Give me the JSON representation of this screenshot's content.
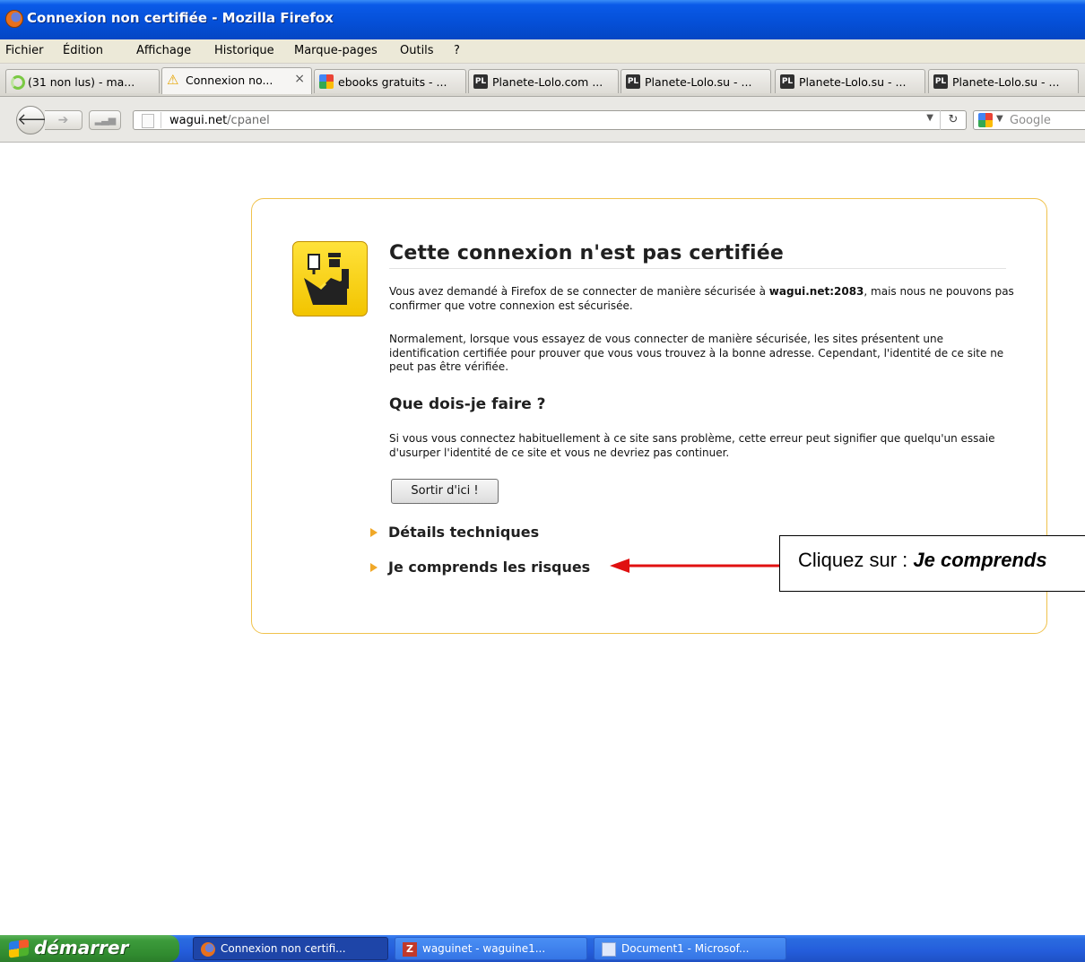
{
  "window": {
    "title": "Connexion non certifiée - Mozilla Firefox"
  },
  "menu": [
    "Fichier",
    "Édition",
    "Affichage",
    "Historique",
    "Marque-pages",
    "Outils",
    "?"
  ],
  "tabs": [
    {
      "label": "(31 non lus) - ma...",
      "icon": "loading-spinner-icon"
    },
    {
      "label": "Connexion no...",
      "icon": "warning-icon",
      "active": true,
      "close": "×"
    },
    {
      "label": "ebooks gratuits - ...",
      "icon": "google-icon"
    },
    {
      "label": "Planete-Lolo.com ...",
      "icon": "pl-icon"
    },
    {
      "label": "Planete-Lolo.su - ...",
      "icon": "pl-icon"
    },
    {
      "label": "Planete-Lolo.su - ...",
      "icon": "pl-icon"
    },
    {
      "label": "Planete-Lolo.su - ...",
      "icon": "pl-icon"
    }
  ],
  "nav": {
    "url_host": "wagui.net",
    "url_path": "/cpanel",
    "search_placeholder": "Google"
  },
  "error": {
    "title": "Cette connexion n'est pas certifiée",
    "p1_before": "Vous avez demandé à Firefox de se connecter de manière sécurisée à ",
    "p1_host": "wagui.net:2083",
    "p1_after": ", mais nous ne pouvons pas confirmer que votre connexion est sécurisée.",
    "p2": "Normalement, lorsque vous essayez de vous connecter de manière sécurisée, les sites présentent une identification certifiée pour prouver que vous vous trouvez à la bonne adresse. Cependant, l'identité de ce site ne peut pas être vérifiée.",
    "what_title": "Que dois-je faire ?",
    "p3": "Si vous vous connectez habituellement à ce site sans problème, cette erreur peut signifier que quelqu'un essaie d'usurper l'identité de ce site et vous ne devriez pas continuer.",
    "get_me_out": "Sortir d'ici !",
    "technical_details": "Détails techniques",
    "understand_risks": "Je comprends les risques"
  },
  "annotation": {
    "text_normal": "Cliquez sur : ",
    "text_bold": "Je comprends",
    "arrow_color": "#e01010"
  },
  "taskbar": {
    "start_label": "démarrer",
    "items": [
      {
        "label": "Connexion non certifi...",
        "icon": "firefox-icon",
        "active": true
      },
      {
        "label": "waguinet - waguine1...",
        "icon": "filezilla-icon"
      },
      {
        "label": "Document1 - Microsof...",
        "icon": "word-document-icon"
      }
    ]
  },
  "colors": {
    "error_border": "#f0c24c",
    "expander_triangle": "#f0a828",
    "titlebar": "#0550d8",
    "taskbar": "#245ddb",
    "start_button": "#318c30"
  }
}
